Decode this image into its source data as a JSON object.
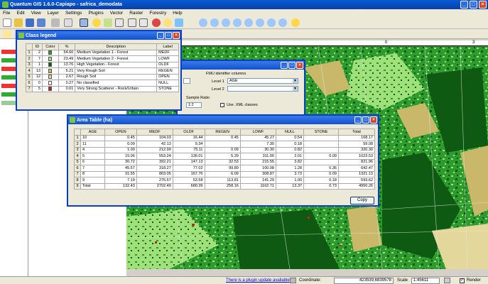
{
  "window": {
    "title": "Quantum GIS 1.6.0-Capiapo - safrica_demodata"
  },
  "menu": [
    "File",
    "Edit",
    "View",
    "Layer",
    "Settings",
    "Plugins",
    "Vector",
    "Raster",
    "Forestry",
    "Help"
  ],
  "ruler": {
    "left_label": "0",
    "right_label": "3"
  },
  "status": {
    "plugin_update": "There is a plugin update available",
    "coordinate_label": "Coordinate:",
    "coordinate_value": "423539,6839578",
    "scale_label": "Scale",
    "scale_value": "1:45611",
    "render_label": "Render"
  },
  "class_legend": {
    "title": "Class legend",
    "columns": [
      "",
      "ID",
      "Color",
      "%",
      "Description",
      "Label"
    ],
    "rows": [
      {
        "n": "1",
        "id": "2",
        "color": "#2e9b2e",
        "pct": "54.60",
        "desc": "Medium Vegetation 1 - Forest",
        "label": "MEDF"
      },
      {
        "n": "2",
        "id": "7",
        "color": "#9fe07a",
        "pct": "23.49",
        "desc": "Medium Vegetation 2 - Forest",
        "label": "LOWF"
      },
      {
        "n": "3",
        "id": "1",
        "color": "#0f5a12",
        "pct": "13.76",
        "desc": "High Vegetation - Forest",
        "label": "OLDF"
      },
      {
        "n": "4",
        "id": "13",
        "color": "#c9b86a",
        "pct": "5.21",
        "desc": "Very Rough Soil",
        "label": "REGEN"
      },
      {
        "n": "5",
        "id": "12",
        "color": "#e4d79c",
        "pct": "2.67",
        "desc": "Rough Soil",
        "label": "OPEN"
      },
      {
        "n": "6",
        "id": "0",
        "color": "#ffffff",
        "pct": "0.27",
        "desc": "No classified",
        "label": "NULL"
      },
      {
        "n": "7",
        "id": "5",
        "color": "#c8201a",
        "pct": "0.01",
        "desc": "Very Strong Scatterer - Rock/Urban",
        "label": "STONE"
      }
    ]
  },
  "back_dialog": {
    "fmu_label": "FMU identifier columns",
    "level1_label": "Level 1",
    "level1_value": "AGE",
    "level2_label": "Level 2",
    "level2_value": "",
    "sample_ratio_label": "Sample Ratio",
    "sample_ratio_value": "1:2",
    "use_xml_label": "Use .XML classes"
  },
  "area_table": {
    "title": "Area Table (ha)",
    "columns": [
      "",
      "AGE",
      "OPEN",
      "MEDF",
      "OLDF",
      "REGEN",
      "LOWF",
      "NULL",
      "STONE",
      "Total"
    ],
    "rows": [
      [
        "1",
        "10",
        "0.45",
        "104.03",
        "16.44",
        "0.45",
        "45.27",
        "0.54",
        "",
        "168.17"
      ],
      [
        "2",
        "11",
        "0.09",
        "42.13",
        "9.34",
        "",
        "7.30",
        "0.18",
        "",
        "59.08"
      ],
      [
        "3",
        "4",
        "1.00",
        "212.99",
        "75.11",
        "0.09",
        "30.30",
        "0.82",
        "",
        "320.30"
      ],
      [
        "4",
        "5",
        "15.06",
        "553.24",
        "136.01",
        "5.29",
        "311.00",
        "2.01",
        "0.09",
        "1023.53"
      ],
      [
        "5",
        "6",
        "30.72",
        "392.21",
        "147.13",
        "32.53",
        "215.55",
        "3.82",
        "",
        "821.96"
      ],
      [
        "6",
        "7",
        "45.57",
        "318.27",
        "77.02",
        "99.89",
        "100.08",
        "1.28",
        "0.36",
        "642.47"
      ],
      [
        "7",
        "8",
        "31.55",
        "803.05",
        "167.76",
        "6.09",
        "308.87",
        "3.73",
        "0.09",
        "1321.13"
      ],
      [
        "8",
        "9",
        "7.19",
        "276.57",
        "53.58",
        "113.81",
        "141.29",
        "1.00",
        "0.18",
        "593.62"
      ],
      [
        "9",
        "Total",
        "132.43",
        "2702.49",
        "680.39",
        "258.16",
        "1162.71",
        "13.37",
        "0.73",
        "4950.26"
      ]
    ],
    "copy_label": "Copy"
  },
  "colors": {
    "forest_dark": "#0f5a12",
    "forest_mid": "#2e9b2e",
    "forest_light": "#9fe07a",
    "soil": "#c9b86a",
    "title_blue": "#0a5bd6"
  }
}
